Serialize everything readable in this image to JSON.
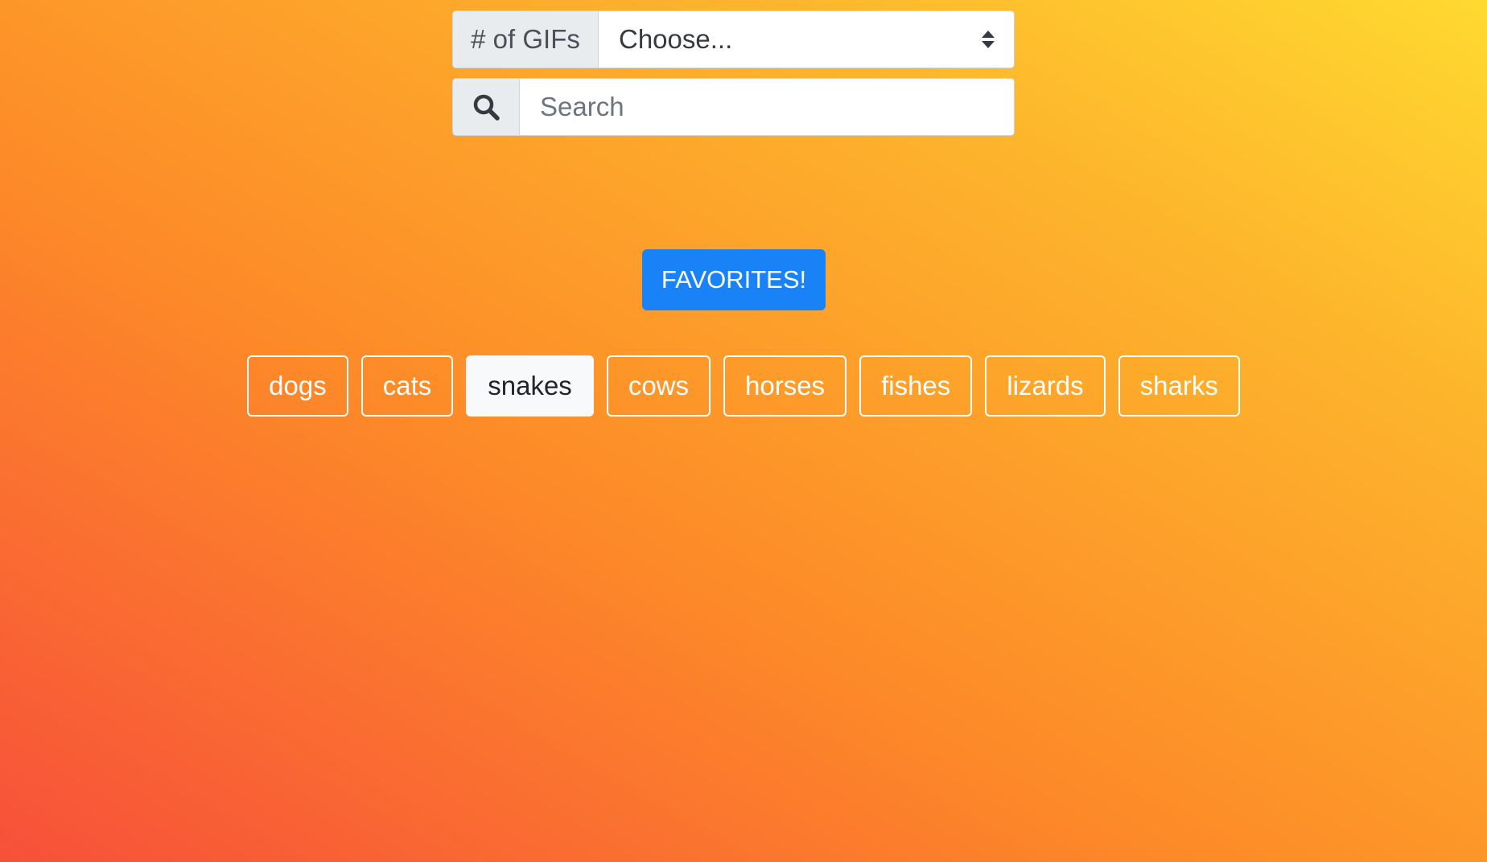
{
  "controls": {
    "gifs_label": "# of GIFs",
    "gifs_select_value": "Choose...",
    "search_icon": "search-icon",
    "search_placeholder": "Search"
  },
  "favorites_label": "FAVORITES!",
  "tags": [
    {
      "label": "dogs",
      "active": false
    },
    {
      "label": "cats",
      "active": false
    },
    {
      "label": "snakes",
      "active": true
    },
    {
      "label": "cows",
      "active": false
    },
    {
      "label": "horses",
      "active": false
    },
    {
      "label": "fishes",
      "active": false
    },
    {
      "label": "lizards",
      "active": false
    },
    {
      "label": "sharks",
      "active": false
    }
  ],
  "colors": {
    "primary_button": "#1a82f7",
    "gradient_top_right": "#ffd930",
    "gradient_bottom_left": "#f7503a"
  }
}
